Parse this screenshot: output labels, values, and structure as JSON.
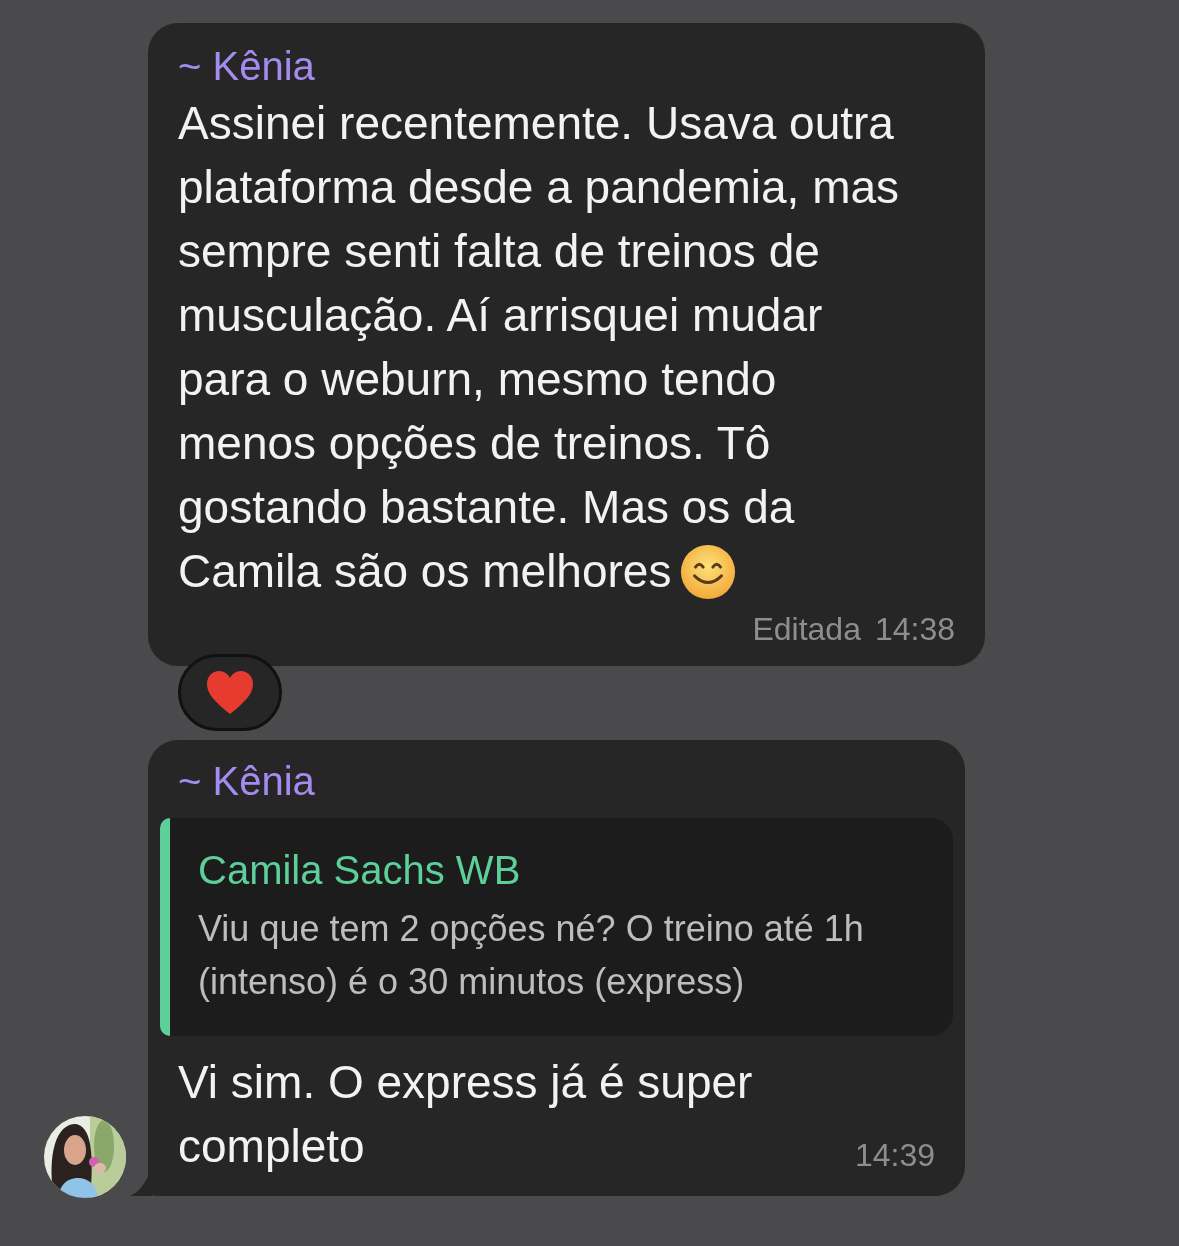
{
  "messages": [
    {
      "sender": "~ Kênia",
      "text": "Assinei recentemente. Usava outra plataforma desde a pandemia, mas sempre senti falta de treinos de musculação. Aí arrisquei mudar para o weburn, mesmo tendo menos opções de treinos. Tô gostando bastante. Mas os da Camila são os melhores",
      "emoji": {
        "kind": "smile"
      },
      "edited": "Editada",
      "time": "14:38",
      "reaction": {
        "kind": "heart"
      }
    },
    {
      "sender": "~ Kênia",
      "quote": {
        "author": "Camila Sachs WB",
        "text": "Viu que tem 2 opções né? O treino até 1h (intenso) é o 30 minutos (express)"
      },
      "text": "Vi sim. O express já é super completo",
      "time": "14:39"
    }
  ]
}
